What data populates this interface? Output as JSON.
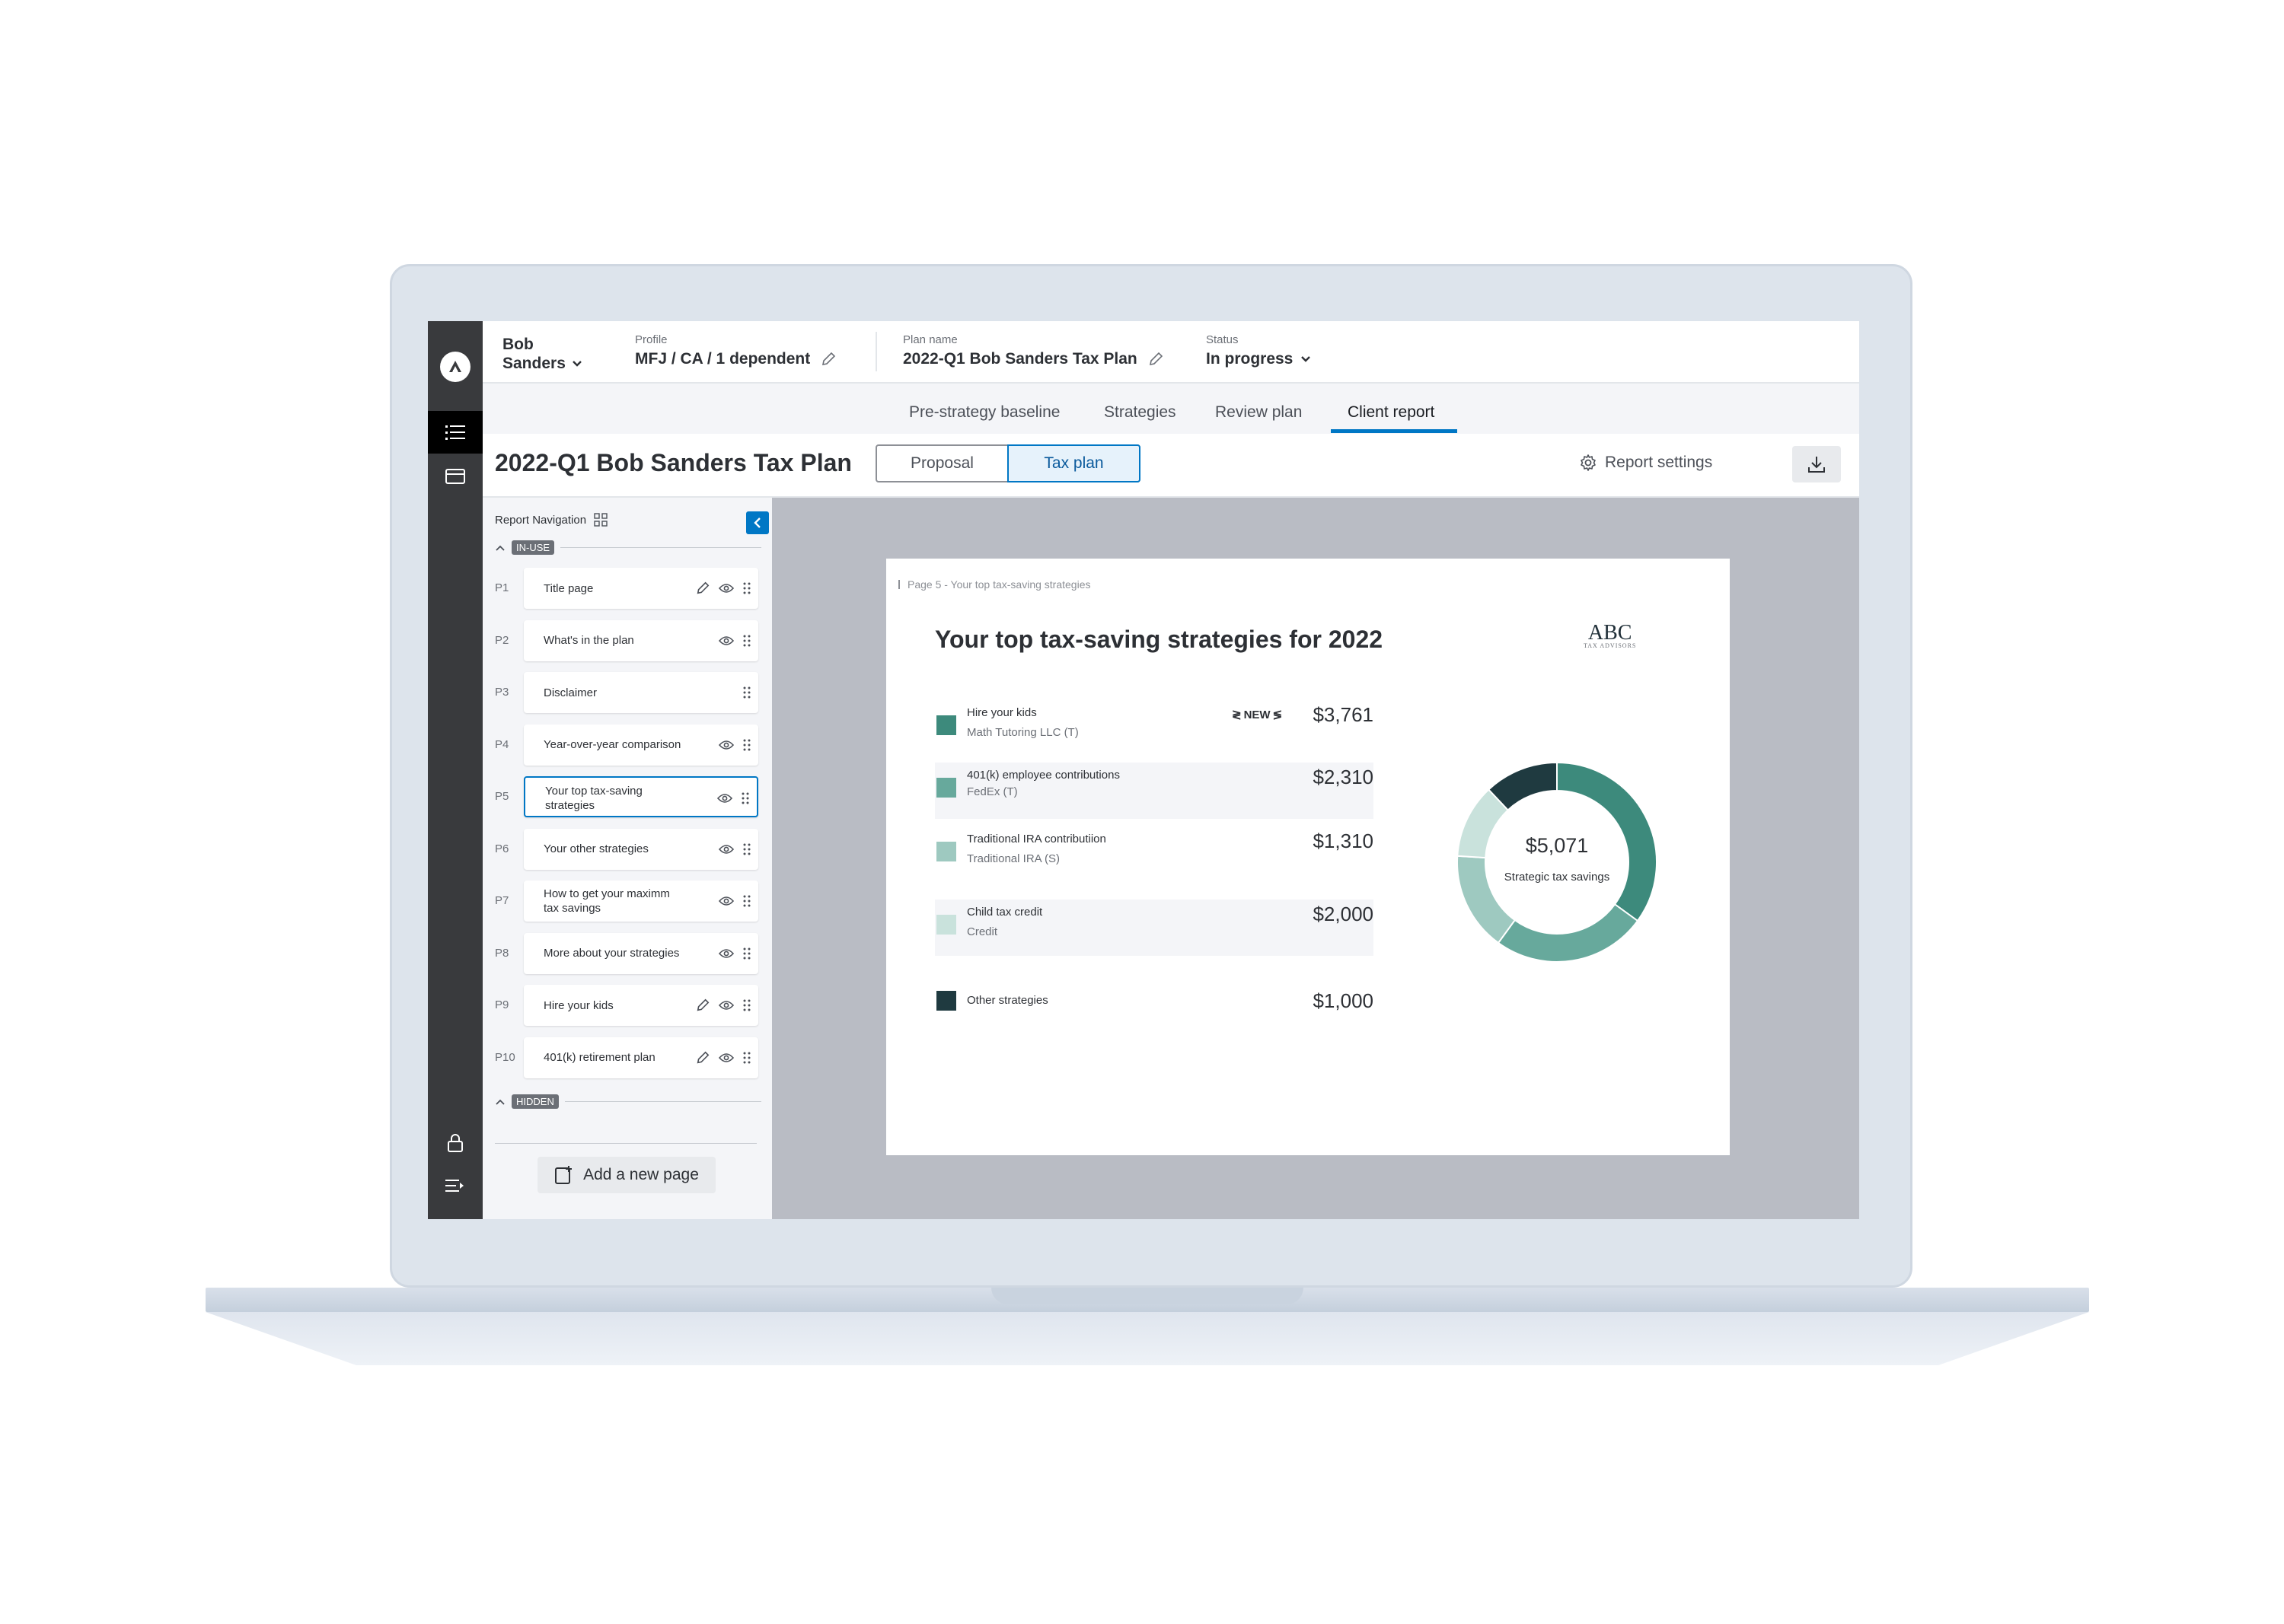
{
  "client": {
    "name_line1": "Bob",
    "name_line2": "Sanders"
  },
  "profile": {
    "label": "Profile",
    "value": "MFJ / CA / 1 dependent"
  },
  "plan": {
    "label": "Plan name",
    "value": "2022-Q1 Bob Sanders Tax Plan"
  },
  "status": {
    "label": "Status",
    "value": "In progress"
  },
  "tabs": [
    {
      "label": "Pre-strategy baseline"
    },
    {
      "label": "Strategies"
    },
    {
      "label": "Review plan"
    },
    {
      "label": "Client report",
      "active": true
    }
  ],
  "header": {
    "title": "2022-Q1 Bob Sanders Tax Plan",
    "seg_options": [
      "Proposal",
      "Tax plan"
    ],
    "seg_selected": "Tax plan",
    "report_settings": "Report settings"
  },
  "nav": {
    "title": "Report Navigation",
    "in_use_label": "IN-USE",
    "hidden_label": "HIDDEN",
    "add_page": "Add a new page",
    "pages": [
      {
        "num": "P1",
        "title": "Title page",
        "edit": true,
        "view": true
      },
      {
        "num": "P2",
        "title": "What's in the plan",
        "edit": false,
        "view": true
      },
      {
        "num": "P3",
        "title": "Disclaimer",
        "edit": false,
        "view": false
      },
      {
        "num": "P4",
        "title": "Year-over-year comparison",
        "edit": false,
        "view": true
      },
      {
        "num": "P5",
        "title": "Your top tax-saving strategies",
        "edit": false,
        "view": true,
        "selected": true
      },
      {
        "num": "P6",
        "title": "Your other strategies",
        "edit": false,
        "view": true
      },
      {
        "num": "P7",
        "title": "How to get your maximm tax savings",
        "edit": false,
        "view": true
      },
      {
        "num": "P8",
        "title": "More about your strategies",
        "edit": false,
        "view": true
      },
      {
        "num": "P9",
        "title": "Hire your kids",
        "edit": true,
        "view": true
      },
      {
        "num": "P10",
        "title": "401(k) retirement plan",
        "edit": true,
        "view": true
      }
    ]
  },
  "doc": {
    "breadcrumb": "Page 5 - Your top tax-saving strategies",
    "title": "Your top tax-saving strategies for 2022",
    "logo_text": "ABC",
    "logo_sub": "TAX ADVISORS",
    "new_tag": "NEW",
    "strategies": [
      {
        "name": "Hire your kids",
        "sub": "Math Tutoring LLC (T)",
        "amount": "$3,761",
        "color": "#3d8a7c",
        "new": true
      },
      {
        "name": "401(k) employee contributions",
        "sub": "FedEx (T)",
        "amount": "$2,310",
        "color": "#67a99c"
      },
      {
        "name": "Traditional IRA contributiion",
        "sub": "Traditional IRA (S)",
        "amount": "$1,310",
        "color": "#9ec9c0"
      },
      {
        "name": "Child tax credit",
        "sub": "Credit",
        "amount": "$2,000",
        "color": "#c9e2dc"
      },
      {
        "name": "Other strategies",
        "sub": "",
        "amount": "$1,000",
        "color": "#1f3a40"
      }
    ],
    "donut_total": "$5,071",
    "donut_label": "Strategic tax savings"
  },
  "chart_data": {
    "type": "pie",
    "donut": true,
    "center_value": "$5,071",
    "center_label": "Strategic tax savings",
    "series": [
      {
        "name": "Hire your kids",
        "value": 35,
        "color": "#3d8a7c"
      },
      {
        "name": "401(k) employee contributions",
        "value": 25,
        "color": "#67a99c"
      },
      {
        "name": "Traditional IRA contributiion",
        "value": 16,
        "color": "#9ec9c0"
      },
      {
        "name": "Child tax credit",
        "value": 12,
        "color": "#c9e2dc"
      },
      {
        "name": "Other strategies",
        "value": 12,
        "color": "#1f3a40"
      }
    ]
  }
}
